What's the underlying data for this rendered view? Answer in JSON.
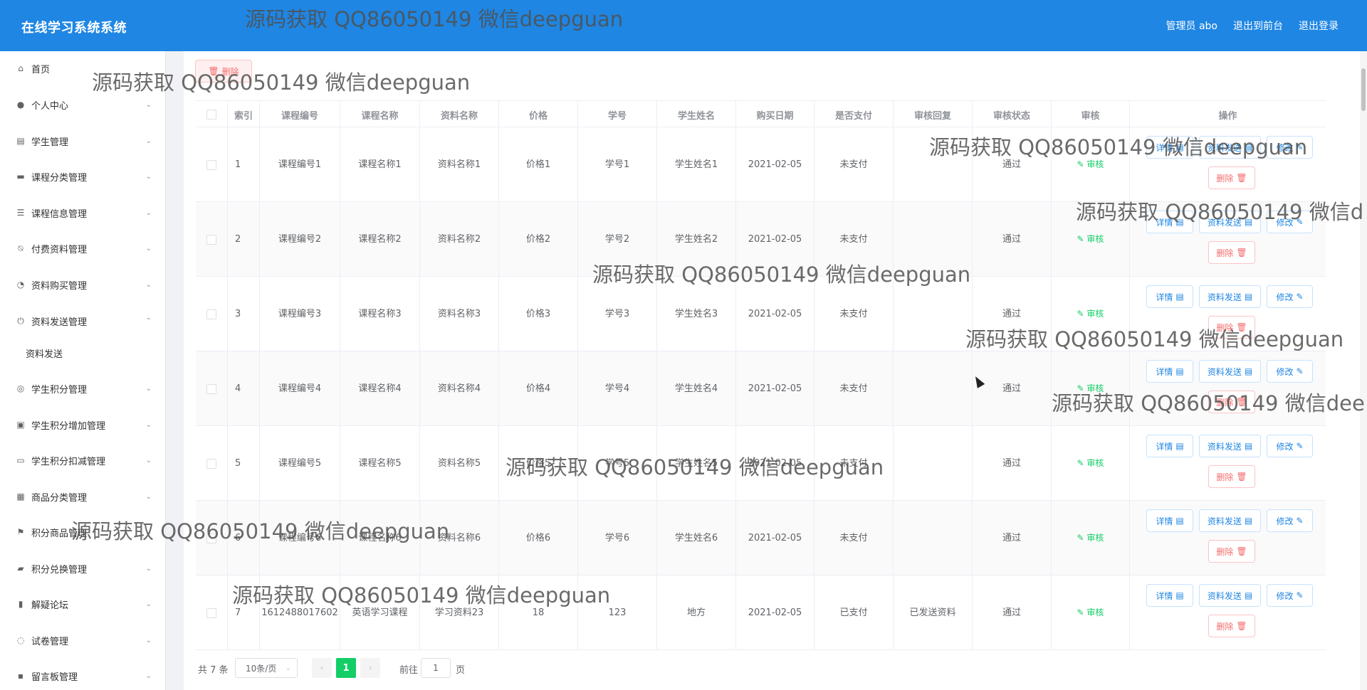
{
  "header": {
    "title": "在线学习系统系统",
    "admin_label": "管理员 abo",
    "front_label": "退出到前台",
    "logout_label": "退出登录"
  },
  "sidebar": {
    "items": [
      {
        "label": "首页",
        "icon": "home-icon",
        "arrow": ""
      },
      {
        "label": "个人中心",
        "icon": "user-icon",
        "arrow": "⌄"
      },
      {
        "label": "学生管理",
        "icon": "clipboard-icon",
        "arrow": "⌄"
      },
      {
        "label": "课程分类管理",
        "icon": "monitor-icon",
        "arrow": "⌄"
      },
      {
        "label": "课程信息管理",
        "icon": "sliders-icon",
        "arrow": "⌄"
      },
      {
        "label": "付费资料管理",
        "icon": "bell-off-icon",
        "arrow": "⌄"
      },
      {
        "label": "资料购买管理",
        "icon": "compass-icon",
        "arrow": "⌄"
      },
      {
        "label": "资料发送管理",
        "icon": "power-icon",
        "arrow": "⌃"
      },
      {
        "label": "学生积分管理",
        "icon": "palette-icon",
        "arrow": "⌄"
      },
      {
        "label": "学生积分增加管理",
        "icon": "briefcase-icon",
        "arrow": "⌄"
      },
      {
        "label": "学生积分扣减管理",
        "icon": "postcard-icon",
        "arrow": "⌄"
      },
      {
        "label": "商品分类管理",
        "icon": "grid-icon",
        "arrow": "⌄"
      },
      {
        "label": "积分商品管理",
        "icon": "flag-icon",
        "arrow": "⌄"
      },
      {
        "label": "积分兑换管理",
        "icon": "wallet-icon",
        "arrow": "⌄"
      },
      {
        "label": "解疑论坛",
        "icon": "chart-icon",
        "arrow": "⌄"
      },
      {
        "label": "试卷管理",
        "icon": "chat-icon",
        "arrow": "⌄"
      },
      {
        "label": "留言板管理",
        "icon": "message-icon",
        "arrow": "⌄"
      }
    ],
    "submenu_label": "资料发送"
  },
  "toolbar": {
    "delete_label": "删除"
  },
  "table": {
    "headers": [
      "索引",
      "课程编号",
      "课程名称",
      "资料名称",
      "价格",
      "学号",
      "学生姓名",
      "购买日期",
      "是否支付",
      "审核回复",
      "审核状态",
      "审核",
      "操作"
    ],
    "rows": [
      {
        "idx": "1",
        "course_no": "课程编号1",
        "course_name": "课程名称1",
        "material": "资料名称1",
        "price": "价格1",
        "student_no": "学号1",
        "student_name": "学生姓名1",
        "date": "2021-02-05",
        "paid": "未支付",
        "reply": "",
        "status": "通过"
      },
      {
        "idx": "2",
        "course_no": "课程编号2",
        "course_name": "课程名称2",
        "material": "资料名称2",
        "price": "价格2",
        "student_no": "学号2",
        "student_name": "学生姓名2",
        "date": "2021-02-05",
        "paid": "未支付",
        "reply": "",
        "status": "通过"
      },
      {
        "idx": "3",
        "course_no": "课程编号3",
        "course_name": "课程名称3",
        "material": "资料名称3",
        "price": "价格3",
        "student_no": "学号3",
        "student_name": "学生姓名3",
        "date": "2021-02-05",
        "paid": "未支付",
        "reply": "",
        "status": "通过"
      },
      {
        "idx": "4",
        "course_no": "课程编号4",
        "course_name": "课程名称4",
        "material": "资料名称4",
        "price": "价格4",
        "student_no": "学号4",
        "student_name": "学生姓名4",
        "date": "2021-02-05",
        "paid": "未支付",
        "reply": "",
        "status": "通过"
      },
      {
        "idx": "5",
        "course_no": "课程编号5",
        "course_name": "课程名称5",
        "material": "资料名称5",
        "price": "价格5",
        "student_no": "学号5",
        "student_name": "学生姓名5",
        "date": "2021-02-05",
        "paid": "未支付",
        "reply": "",
        "status": "通过"
      },
      {
        "idx": "6",
        "course_no": "课程编号6",
        "course_name": "课程名称6",
        "material": "资料名称6",
        "price": "价格6",
        "student_no": "学号6",
        "student_name": "学生姓名6",
        "date": "2021-02-05",
        "paid": "未支付",
        "reply": "",
        "status": "通过"
      },
      {
        "idx": "7",
        "course_no": "1612488017602",
        "course_name": "英语学习课程",
        "material": "学习资料23",
        "price": "18",
        "student_no": "123",
        "student_name": "地方",
        "date": "2021-02-05",
        "paid": "已支付",
        "reply": "已发送资料",
        "status": "通过"
      }
    ],
    "audit_label": "审核",
    "detail_label": "详情",
    "send_label": "资料发送",
    "edit_label": "修改",
    "delete_label": "删除"
  },
  "pagination": {
    "total": "共 7 条",
    "page_size": "10条/页",
    "current_page": "1",
    "goto_prefix": "前往",
    "goto_value": "1",
    "goto_suffix": "页"
  },
  "watermark": {
    "text": "源码获取 QQ86050149 微信deepguan",
    "text_cut1": "源码获取 QQ86050149 微信d",
    "text_cut2": "源码获取 QQ86050149 微信dee"
  }
}
